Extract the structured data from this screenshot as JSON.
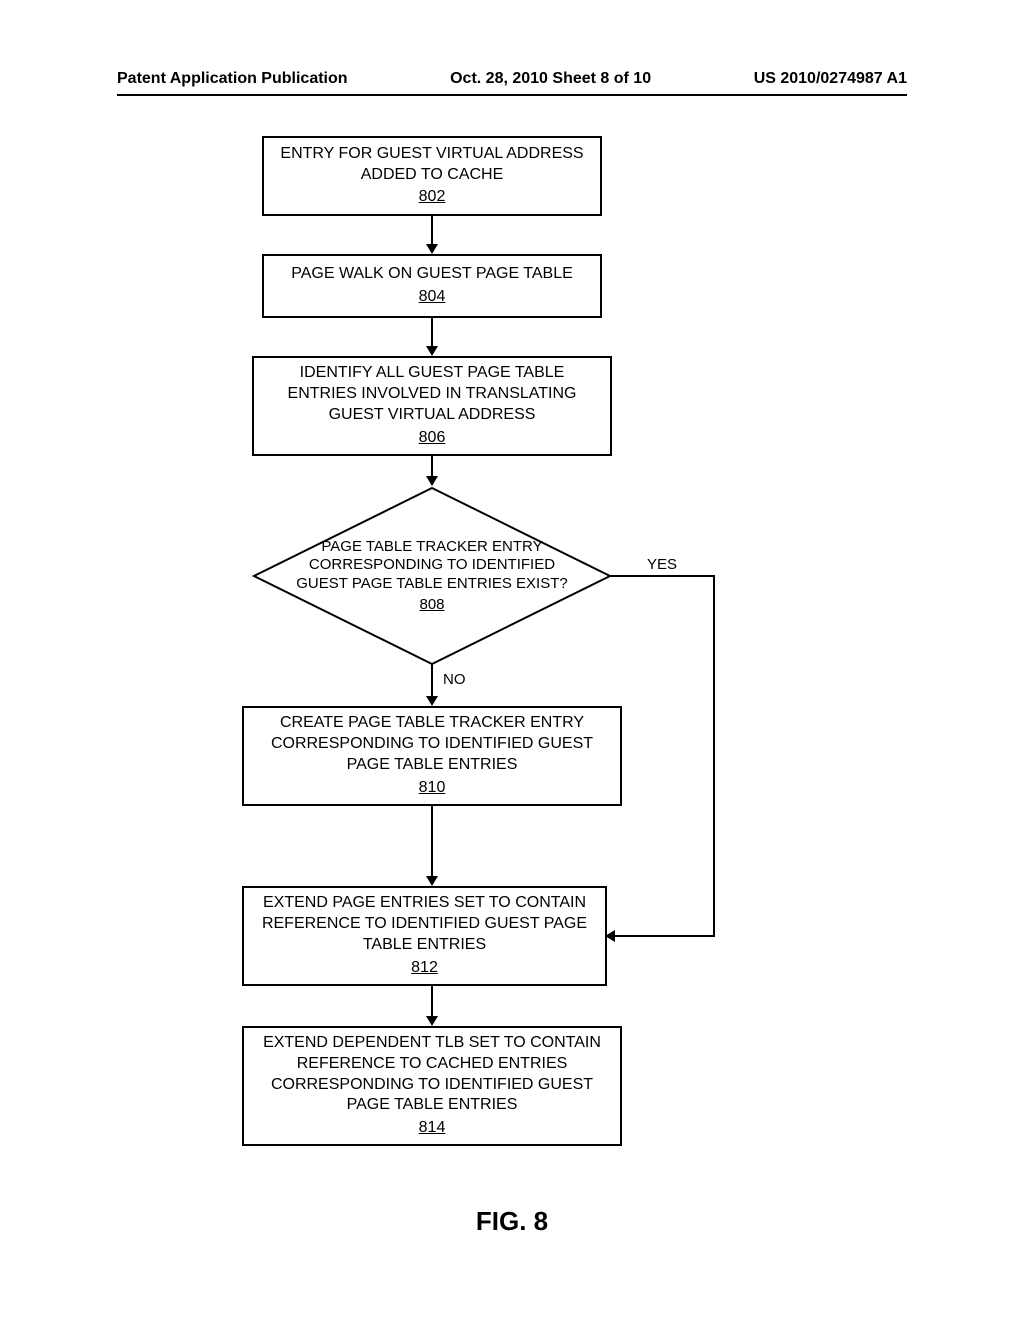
{
  "header": {
    "left": "Patent Application Publication",
    "center": "Oct. 28, 2010   Sheet 8 of 10",
    "right": "US 2010/0274987 A1"
  },
  "boxes": {
    "b802": {
      "text": "ENTRY FOR GUEST VIRTUAL ADDRESS ADDED TO CACHE",
      "ref": "802"
    },
    "b804": {
      "text": "PAGE WALK ON GUEST PAGE TABLE",
      "ref": "804"
    },
    "b806": {
      "text": "IDENTIFY ALL GUEST PAGE TABLE ENTRIES INVOLVED IN TRANSLATING GUEST VIRTUAL ADDRESS",
      "ref": "806"
    },
    "d808": {
      "text": "PAGE TABLE TRACKER ENTRY CORRESPONDING TO IDENTIFIED GUEST PAGE TABLE ENTRIES EXIST?",
      "ref": "808"
    },
    "b810": {
      "text": "CREATE PAGE TABLE TRACKER ENTRY CORRESPONDING TO IDENTIFIED GUEST PAGE TABLE ENTRIES",
      "ref": "810"
    },
    "b812": {
      "text": "EXTEND PAGE ENTRIES SET TO CONTAIN REFERENCE TO IDENTIFIED GUEST PAGE TABLE ENTRIES",
      "ref": "812"
    },
    "b814": {
      "text": "EXTEND DEPENDENT TLB SET TO CONTAIN REFERENCE TO CACHED ENTRIES CORRESPONDING TO IDENTIFIED GUEST PAGE TABLE ENTRIES",
      "ref": "814"
    }
  },
  "labels": {
    "yes": "YES",
    "no": "NO"
  },
  "figure_caption": "FIG. 8"
}
